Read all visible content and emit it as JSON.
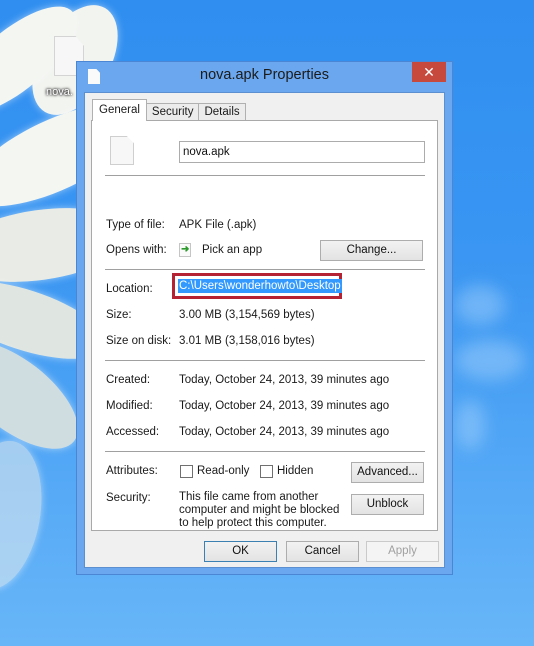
{
  "desktop": {
    "icon_label": "nova.",
    "icon_name": "file-icon"
  },
  "window": {
    "title": "nova.apk Properties",
    "close_glyph": "✕",
    "tabs": [
      {
        "label": "General",
        "active": true
      },
      {
        "label": "Security",
        "active": false
      },
      {
        "label": "Details",
        "active": false
      }
    ]
  },
  "general": {
    "file_name": "nova.apk",
    "type_label": "Type of file:",
    "type_value": "APK File (.apk)",
    "opens_label": "Opens with:",
    "opens_value": "Pick an app",
    "change_button": "Change...",
    "location_label": "Location:",
    "location_value": "C:\\Users\\wonderhowto\\Desktop",
    "size_label": "Size:",
    "size_value": "3.00 MB (3,154,569 bytes)",
    "size_disk_label": "Size on disk:",
    "size_disk_value": "3.01 MB (3,158,016 bytes)",
    "created_label": "Created:",
    "created_value": "Today, October 24, 2013, 39 minutes ago",
    "modified_label": "Modified:",
    "modified_value": "Today, October 24, 2013, 39 minutes ago",
    "accessed_label": "Accessed:",
    "accessed_value": "Today, October 24, 2013, 39 minutes ago",
    "attributes_label": "Attributes:",
    "readonly_label": "Read-only",
    "readonly_checked": false,
    "hidden_label": "Hidden",
    "hidden_checked": false,
    "advanced_button": "Advanced...",
    "security_label": "Security:",
    "security_text": "This file came from another computer and might be blocked to help protect this computer.",
    "unblock_button": "Unblock"
  },
  "footer": {
    "ok": "OK",
    "cancel": "Cancel",
    "apply": "Apply"
  },
  "colors": {
    "highlight_box": "#b42234",
    "selection": "#3399ff",
    "close_button": "#c7493d",
    "window_frame": "#6ba7ee"
  }
}
